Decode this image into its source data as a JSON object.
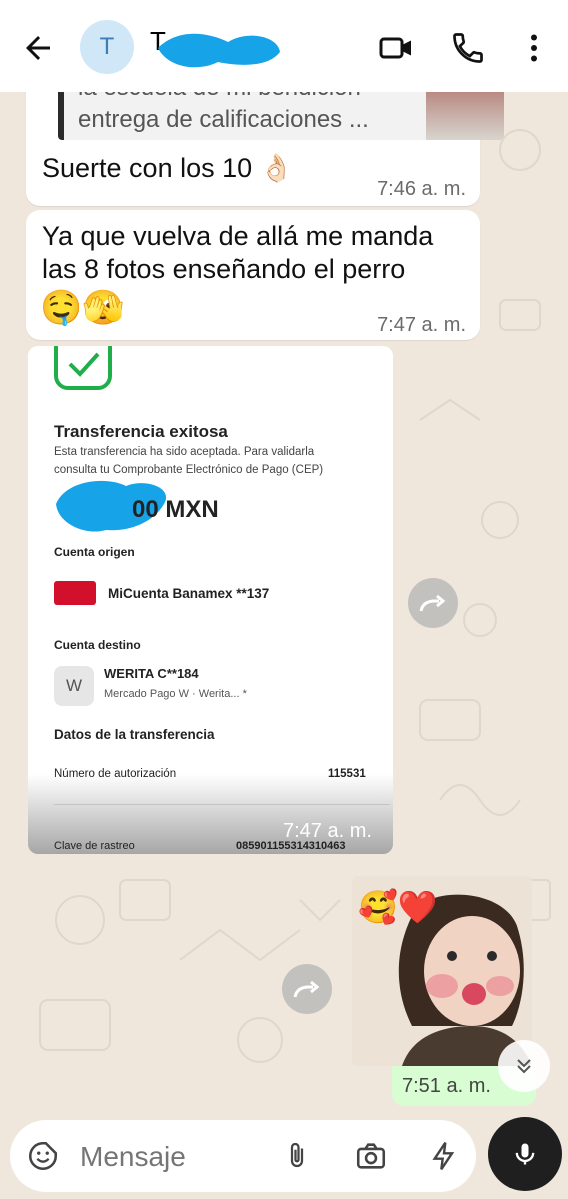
{
  "header": {
    "avatar_initial": "T",
    "contact_name": "T"
  },
  "messages": {
    "quoted": {
      "line1": "la escuela de mi bendición",
      "line2": "entrega de calificaciones ..."
    },
    "m1": {
      "text": "Suerte con los 10 👌🏻",
      "time": "7:46 a. m."
    },
    "m2": {
      "line1": "Ya que vuelva de allá me manda",
      "line2": "las 8 fotos enseñando el perro",
      "emoji": "🤤🫣",
      "time": "7:47 a. m."
    },
    "receipt": {
      "title": "Transferencia exitosa",
      "desc1": "Esta transferencia ha sido aceptada. Para validarla",
      "desc2": "consulta tu Comprobante Electrónico de Pago (CEP)",
      "amount_suffix": "00 MXN",
      "origin_label": "Cuenta origen",
      "origin_account": "MiCuenta Banamex **137",
      "dest_label": "Cuenta destino",
      "dest_icon": "W",
      "dest_name": "WERITA C**184",
      "dest_sub": "Mercado Pago W · Werita... *",
      "data_label": "Datos de la transferencia",
      "auth_label": "Número de autorización",
      "auth_value": "115531",
      "track_label": "Clave de rastreo",
      "track_value": "085901155314310463",
      "time": "7:47 a. m."
    },
    "photo": {
      "emoji": "🥰❤️",
      "time": "7:51 a. m."
    }
  },
  "input": {
    "placeholder": "Mensaje"
  },
  "colors": {
    "accent_green": "#1fae4a",
    "sent_bubble": "#d9fdd3",
    "chat_bg": "#efe7dc"
  }
}
